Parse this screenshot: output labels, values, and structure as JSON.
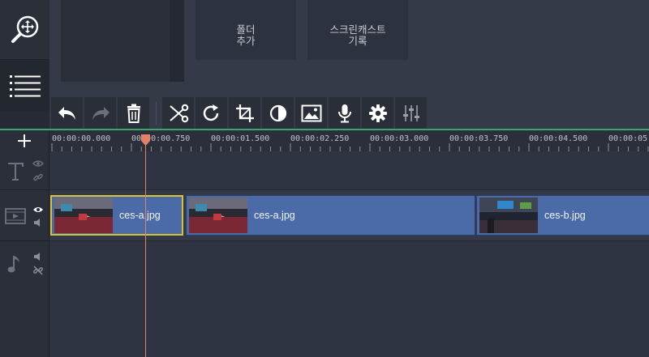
{
  "left_toolbar": {
    "items": [
      {
        "name": "zoom-move-icon"
      },
      {
        "name": "list-icon"
      }
    ]
  },
  "media": {
    "cards": [
      {
        "label": "폴더\n추가"
      },
      {
        "label": "스크린캐스트\n기록"
      }
    ]
  },
  "toolbar": {
    "buttons": [
      "undo-icon",
      "redo-icon",
      "delete-icon",
      "cut-icon",
      "rotate-icon",
      "crop-icon",
      "color-adjust-icon",
      "image-icon",
      "microphone-icon",
      "settings-icon",
      "equalizer-icon"
    ]
  },
  "ruler": {
    "ticks": [
      "00:00:00.000",
      "00:00:00.750",
      "00:00:01.500",
      "00:00:02.250",
      "00:00:03.000",
      "00:00:03.750",
      "00:00:04.500",
      "00:00:05"
    ]
  },
  "timeline": {
    "add_label": "+",
    "clips": [
      {
        "name": "ces-a.jpg",
        "selected": true
      },
      {
        "name": "ces-a.jpg",
        "selected": false
      },
      {
        "name": "ces-b.jpg",
        "selected": false
      }
    ]
  },
  "colors": {
    "accent_green": "#3aa56f",
    "clip_blue": "#4a6aa8",
    "selection": "#d8c236",
    "playhead": "#e4806a"
  }
}
